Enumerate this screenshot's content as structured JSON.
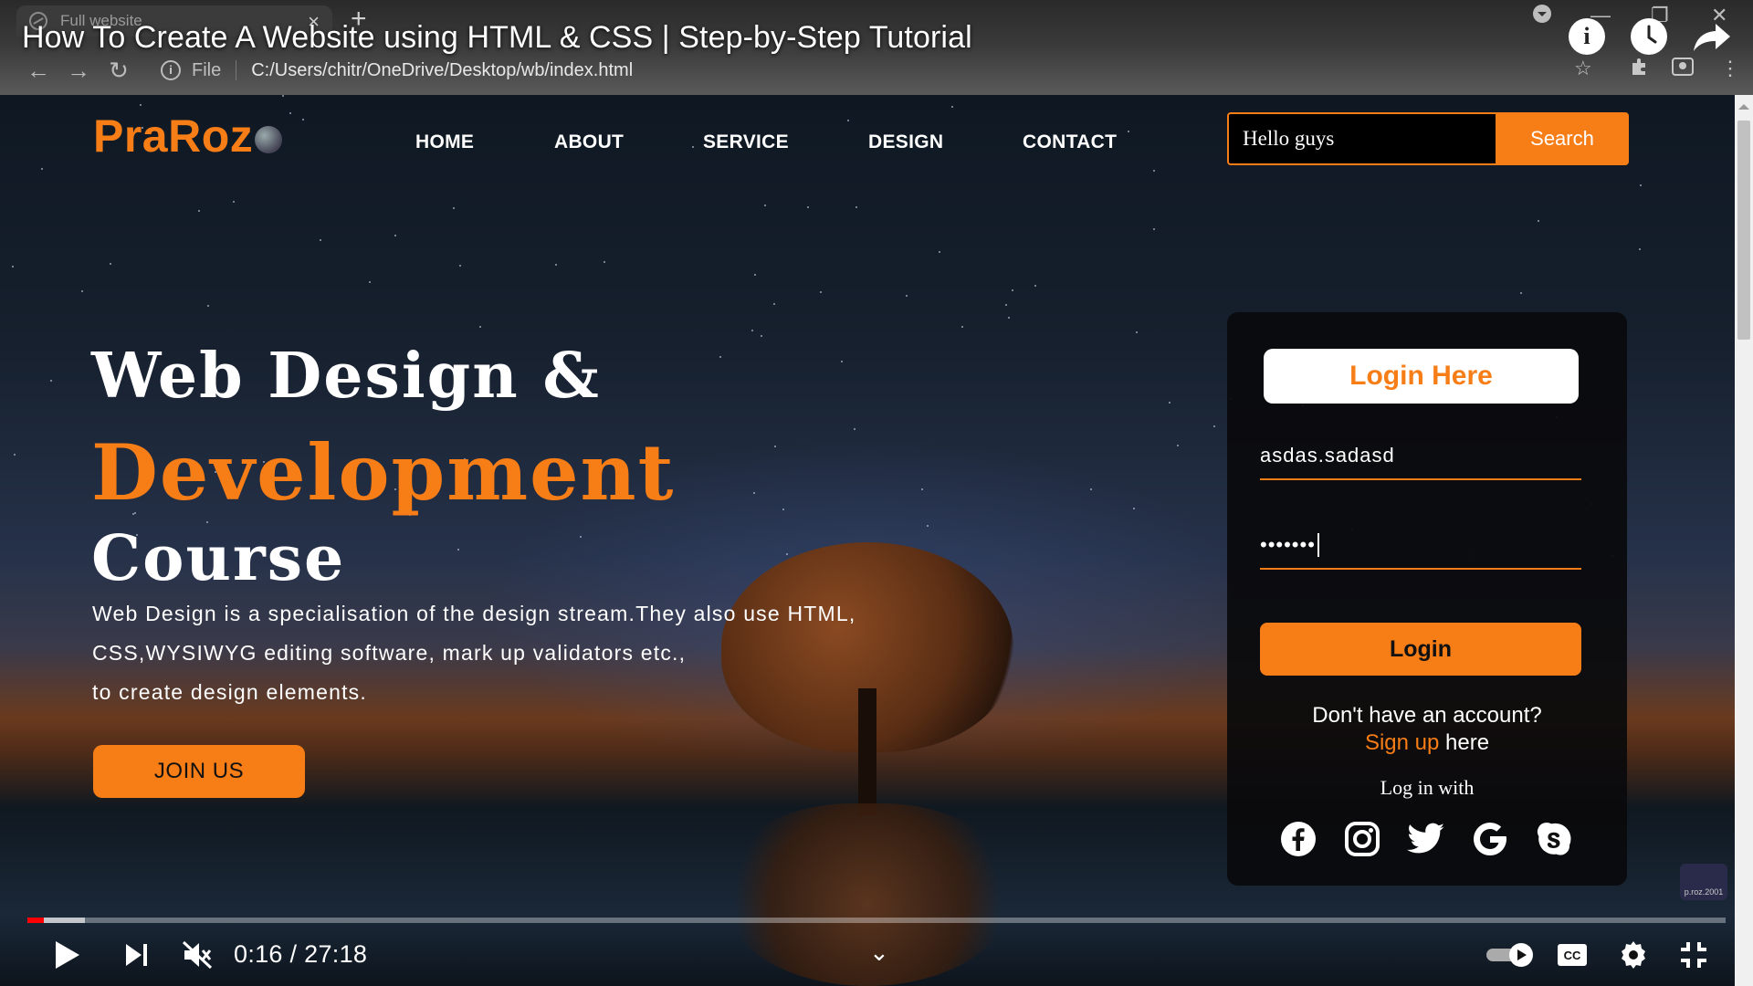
{
  "browser": {
    "tab_title": "Full website",
    "url_prefix": "File",
    "url": "C:/Users/chitr/OneDrive/Desktop/wb/index.html"
  },
  "video": {
    "title": "How To Create A Website using HTML & CSS | Step-by-Step Tutorial",
    "time_current": "0:16",
    "time_total": "27:18",
    "time_display": "0:16 / 27:18",
    "played_fraction": 0.0098,
    "buffered_fraction": 0.034,
    "muted": true,
    "captions": "CC",
    "watermark": "p.roz.2001"
  },
  "site": {
    "logo": "PraRoz",
    "nav": [
      "HOME",
      "ABOUT",
      "SERVICE",
      "DESIGN",
      "CONTACT"
    ],
    "search": {
      "value": "Hello guys",
      "button": "Search"
    },
    "hero": {
      "line1": "Web Design &",
      "line2": "Development",
      "line3": "Course",
      "para1": "Web Design is a specialisation of the design stream.They also use HTML,",
      "para2": "CSS,WYSIWYG editing software, mark up validators etc.,",
      "para3": "to create design elements.",
      "cta": "JOIN US"
    },
    "login": {
      "heading": "Login Here",
      "username": "asdas.sadasd",
      "password_mask": "•••••••",
      "button": "Login",
      "no_account": "Don't have an account?",
      "sign_up": "Sign up",
      "sign_up_suffix": " here",
      "log_in_with": "Log in with",
      "social": [
        "facebook",
        "instagram",
        "twitter",
        "google",
        "skype"
      ]
    }
  },
  "colors": {
    "accent": "#f77d17",
    "progress": "#ff0000"
  }
}
